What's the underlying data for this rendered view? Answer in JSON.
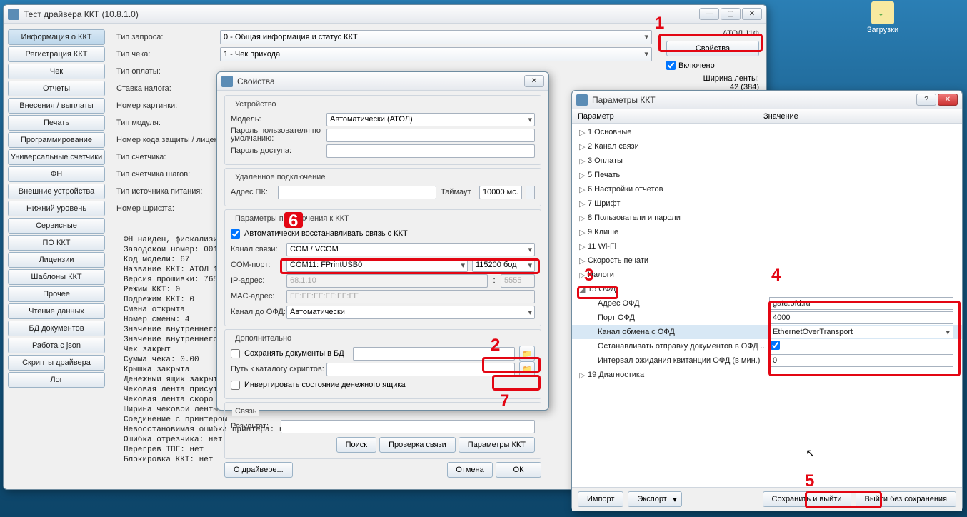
{
  "desktop": {
    "downloads": "Загрузки"
  },
  "main": {
    "title": "Тест драйвера ККТ (10.8.1.0)",
    "nav": [
      "Информация о ККТ",
      "Регистрация ККТ",
      "Чек",
      "Отчеты",
      "Внесения / выплаты",
      "Печать",
      "Программирование",
      "Универсальные счетчики",
      "ФН",
      "Внешние устройства",
      "Нижний уровень",
      "Сервисные",
      "ПО ККТ",
      "Лицензии",
      "Шаблоны ККТ",
      "Прочее",
      "Чтение данных",
      "БД документов",
      "Работа с json",
      "Скрипты драйвера",
      "Лог"
    ],
    "form": {
      "tip_zaprosa_lbl": "Тип запроса:",
      "tip_zaprosa_val": "0 - Общая информация и статус ККТ",
      "tip_cheka_lbl": "Тип чека:",
      "tip_cheka_val": "1 - Чек прихода",
      "tip_oplaty_lbl": "Тип оплаты:",
      "stavka_lbl": "Ставка налога:",
      "nomer_kart_lbl": "Номер картинки:",
      "tip_modulya_lbl": "Тип модуля:",
      "kod_zashchity_lbl": "Номер кода защиты / лицензии",
      "tip_schetchika_lbl": "Тип счетчика:",
      "tip_schetchika_shagov_lbl": "Тип счетчика шагов:",
      "tip_istochnika_lbl": "Тип источника питания:",
      "nomer_shrifta_lbl": "Номер шрифта:"
    },
    "right": {
      "model": "АТОЛ 11Ф",
      "svoystva_btn": "Свойства",
      "vklyucheno": "Включено",
      "shirina_lbl": "Ширина ленты:",
      "shirina_val": "42 (384)"
    },
    "log": "ФН найден, фискализиро\nЗаводской номер: 00106\nКод модели: 67\nНазвание ККТ: АТОЛ 11Ф\nВерсия прошивки: 7651\nРежим ККТ: 0\nПодрежим ККТ: 0\nСмена открыта\nНомер смены: 4\nЗначение внутреннего с\nЗначение внутреннего с\nЧек закрыт\nСумма чека: 0.00\nКрышка закрыта\nДенежный ящик закрыт\nЧековая лента присутс\nЧековая лента скоро за\nШирина чековой ленты:\nСоединение с принтером\nНевосстановимая ошибка принтера: нет\nОшибка отрезчика: нет\nПерегрев ТПГ: нет\nБлокировка ККТ: нет"
  },
  "props": {
    "title": "Свойства",
    "group_device": "Устройство",
    "model_lbl": "Модель:",
    "model_val": "Автоматически (АТОЛ)",
    "pwd_user_lbl": "Пароль пользователя по умолчанию:",
    "pwd_access_lbl": "Пароль доступа:",
    "group_remote": "Удаленное подключение",
    "pc_addr_lbl": "Адрес ПК:",
    "timeout_lbl": "Таймаут",
    "timeout_val": "10000 мс.",
    "group_conn": "Параметры подключения к ККТ",
    "auto_restore": "Автоматически восстанавливать связь с ККТ",
    "kanal_lbl": "Канал связи:",
    "kanal_val": "COM / VCOM",
    "com_lbl": "COM-порт:",
    "com_val": "COM11: FPrintUSB0",
    "baud_val": "115200 бод",
    "ip_lbl": "IP-адрес:",
    "ip_val": "68.1.10",
    "ip_port": "5555",
    "mac_lbl": "MAC-адрес:",
    "mac_val": "FF:FF:FF:FF:FF:FF",
    "ofd_lbl": "Канал до ОФД:",
    "ofd_val": "Автоматически",
    "group_extra": "Дополнительно",
    "save_docs": "Сохранять документы в БД",
    "scripts_lbl": "Путь к каталогу скриптов:",
    "invert_drawer": "Инвертировать состояние денежного ящика",
    "group_link": "Связь",
    "result_lbl": "Результат:",
    "btn_search": "Поиск",
    "btn_check": "Проверка связи",
    "btn_params": "Параметры ККТ",
    "btn_about": "О драйвере...",
    "btn_cancel": "Отмена",
    "btn_ok": "ОК"
  },
  "params": {
    "title": "Параметры ККТ",
    "col_param": "Параметр",
    "col_value": "Значение",
    "nodes": [
      "1 Основные",
      "2 Канал связи",
      "3 Оплаты",
      "5 Печать",
      "6 Настройки отчетов",
      "7 Шрифт",
      "8 Пользователи и пароли",
      "9 Клише",
      "11 Wi-Fi",
      "Скорость печати",
      "Налоги",
      "15 ОФД",
      "19 Диагностика"
    ],
    "ofd": {
      "addr_lbl": "Адрес ОФД",
      "addr_val": "gate.ofd.ru",
      "port_lbl": "Порт ОФД",
      "port_val": "4000",
      "channel_lbl": "Канал обмена с ОФД",
      "channel_val": "EthernetOverTransport",
      "stop_lbl": "Останавливать отправку документов в ОФД ...",
      "interval_lbl": "Интервал ожидания квитанции ОФД (в мин.)",
      "interval_val": "0"
    },
    "btn_import": "Импорт",
    "btn_export": "Экспорт",
    "btn_save": "Сохранить и выйти",
    "btn_exit": "Выйти без сохранения"
  },
  "annotations": {
    "n1": "1",
    "n2": "2",
    "n3": "3",
    "n4": "4",
    "n5": "5",
    "n6": "6",
    "n7": "7"
  }
}
